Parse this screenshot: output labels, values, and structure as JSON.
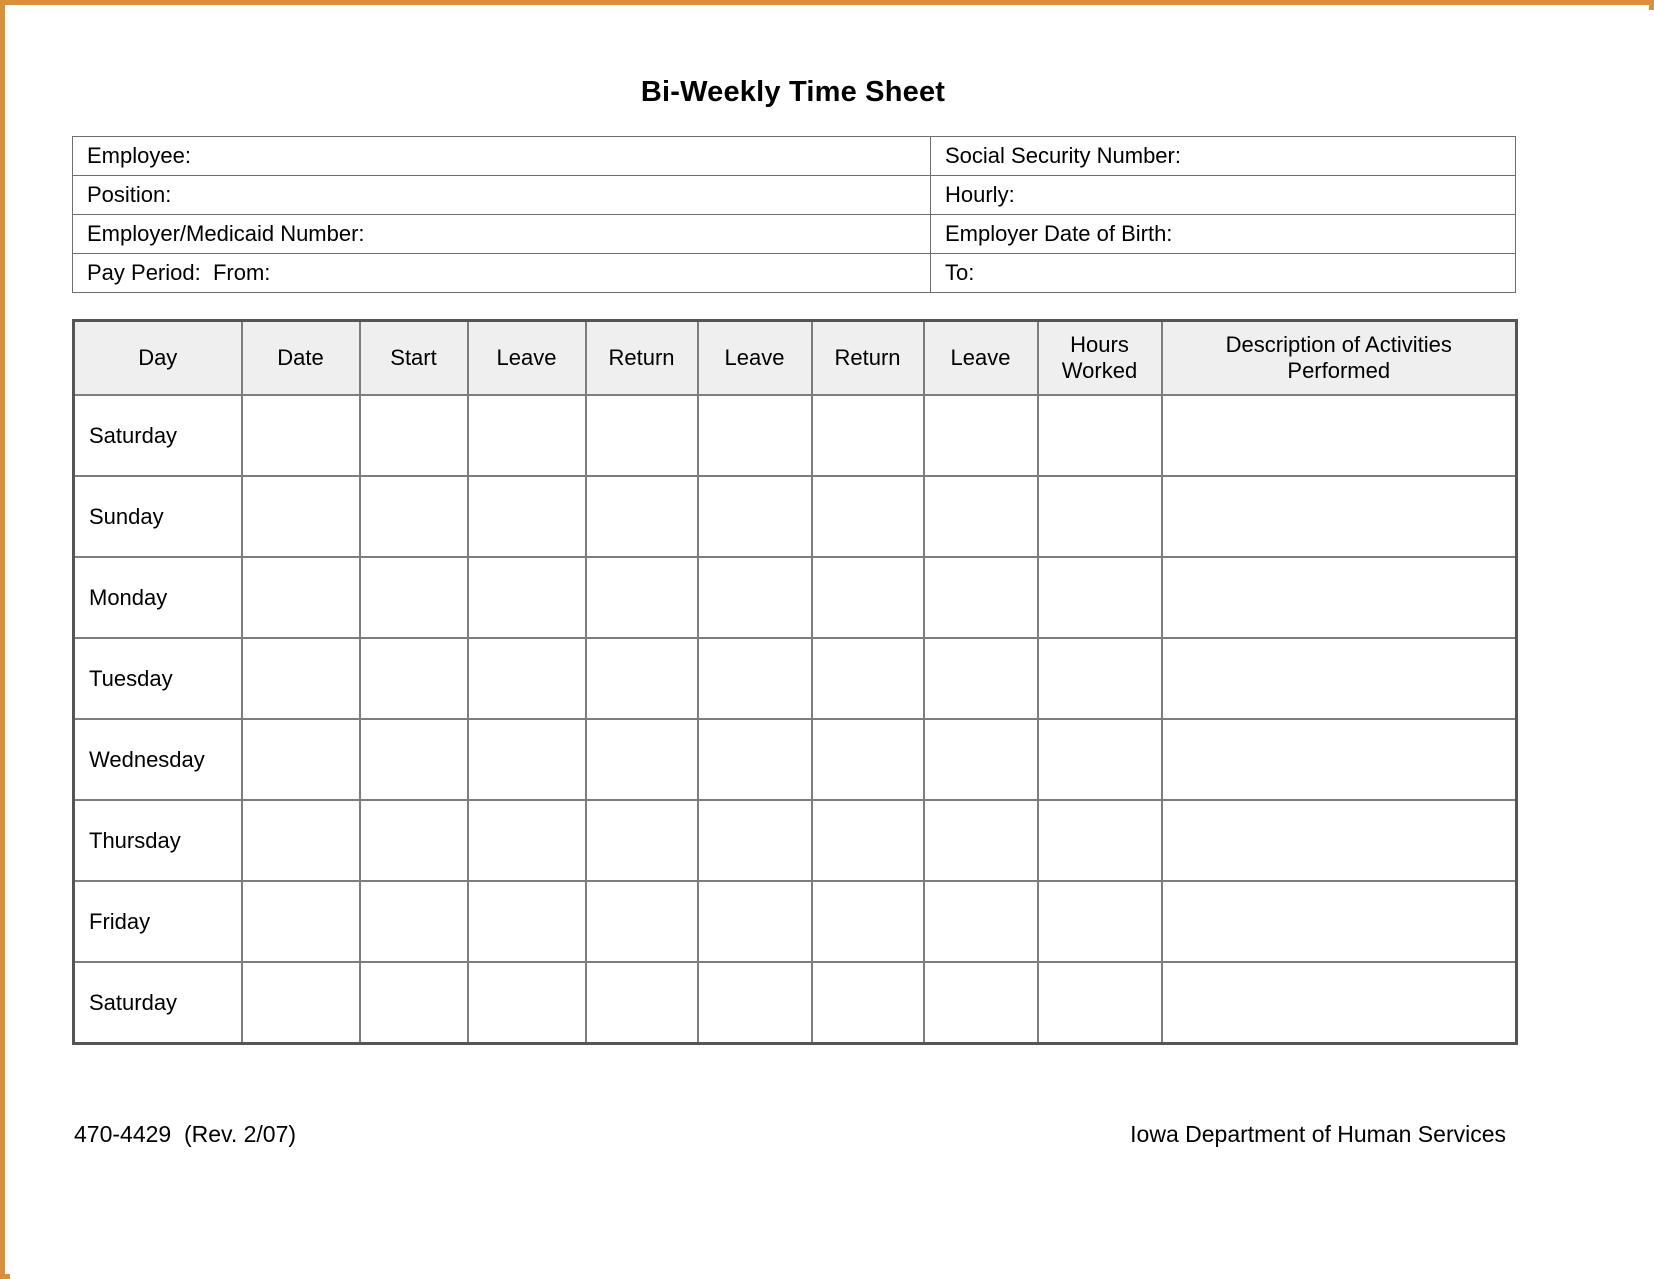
{
  "document": {
    "title": "Bi-Weekly Time Sheet"
  },
  "info_fields": {
    "rows": [
      {
        "left": "Employee:",
        "right": "Social Security Number:"
      },
      {
        "left": "Position:",
        "right": "Hourly:"
      },
      {
        "left": "Employer/Medicaid Number:",
        "right": "Employer Date of Birth:"
      },
      {
        "left": "Pay Period:  From:",
        "right": "To:"
      }
    ]
  },
  "timesheet": {
    "columns": [
      "Day",
      "Date",
      "Start",
      "Leave",
      "Return",
      "Leave",
      "Return",
      "Leave",
      "Hours\nWorked",
      "Description of Activities\nPerformed"
    ],
    "column_header_hours_line1": "Hours",
    "column_header_hours_line2": "Worked",
    "column_header_desc_line1": "Description of Activities",
    "column_header_desc_line2": "Performed",
    "rows": [
      {
        "day": "Saturday",
        "date": "",
        "start": "",
        "leave1": "",
        "return1": "",
        "leave2": "",
        "return2": "",
        "leave3": "",
        "hours_worked": "",
        "description": ""
      },
      {
        "day": "Sunday",
        "date": "",
        "start": "",
        "leave1": "",
        "return1": "",
        "leave2": "",
        "return2": "",
        "leave3": "",
        "hours_worked": "",
        "description": ""
      },
      {
        "day": "Monday",
        "date": "",
        "start": "",
        "leave1": "",
        "return1": "",
        "leave2": "",
        "return2": "",
        "leave3": "",
        "hours_worked": "",
        "description": ""
      },
      {
        "day": "Tuesday",
        "date": "",
        "start": "",
        "leave1": "",
        "return1": "",
        "leave2": "",
        "return2": "",
        "leave3": "",
        "hours_worked": "",
        "description": ""
      },
      {
        "day": "Wednesday",
        "date": "",
        "start": "",
        "leave1": "",
        "return1": "",
        "leave2": "",
        "return2": "",
        "leave3": "",
        "hours_worked": "",
        "description": ""
      },
      {
        "day": "Thursday",
        "date": "",
        "start": "",
        "leave1": "",
        "return1": "",
        "leave2": "",
        "return2": "",
        "leave3": "",
        "hours_worked": "",
        "description": ""
      },
      {
        "day": "Friday",
        "date": "",
        "start": "",
        "leave1": "",
        "return1": "",
        "leave2": "",
        "return2": "",
        "leave3": "",
        "hours_worked": "",
        "description": ""
      },
      {
        "day": "Saturday",
        "date": "",
        "start": "",
        "leave1": "",
        "return1": "",
        "leave2": "",
        "return2": "",
        "leave3": "",
        "hours_worked": "",
        "description": ""
      }
    ]
  },
  "footer": {
    "form_number": "470-4429  (Rev. 2/07)",
    "agency": "Iowa Department of Human Services"
  },
  "colors": {
    "scan_frame": "#d8913a",
    "header_fill": "#efefef",
    "grid_line": "#7d7d7d",
    "page_background": "#ffffff"
  }
}
